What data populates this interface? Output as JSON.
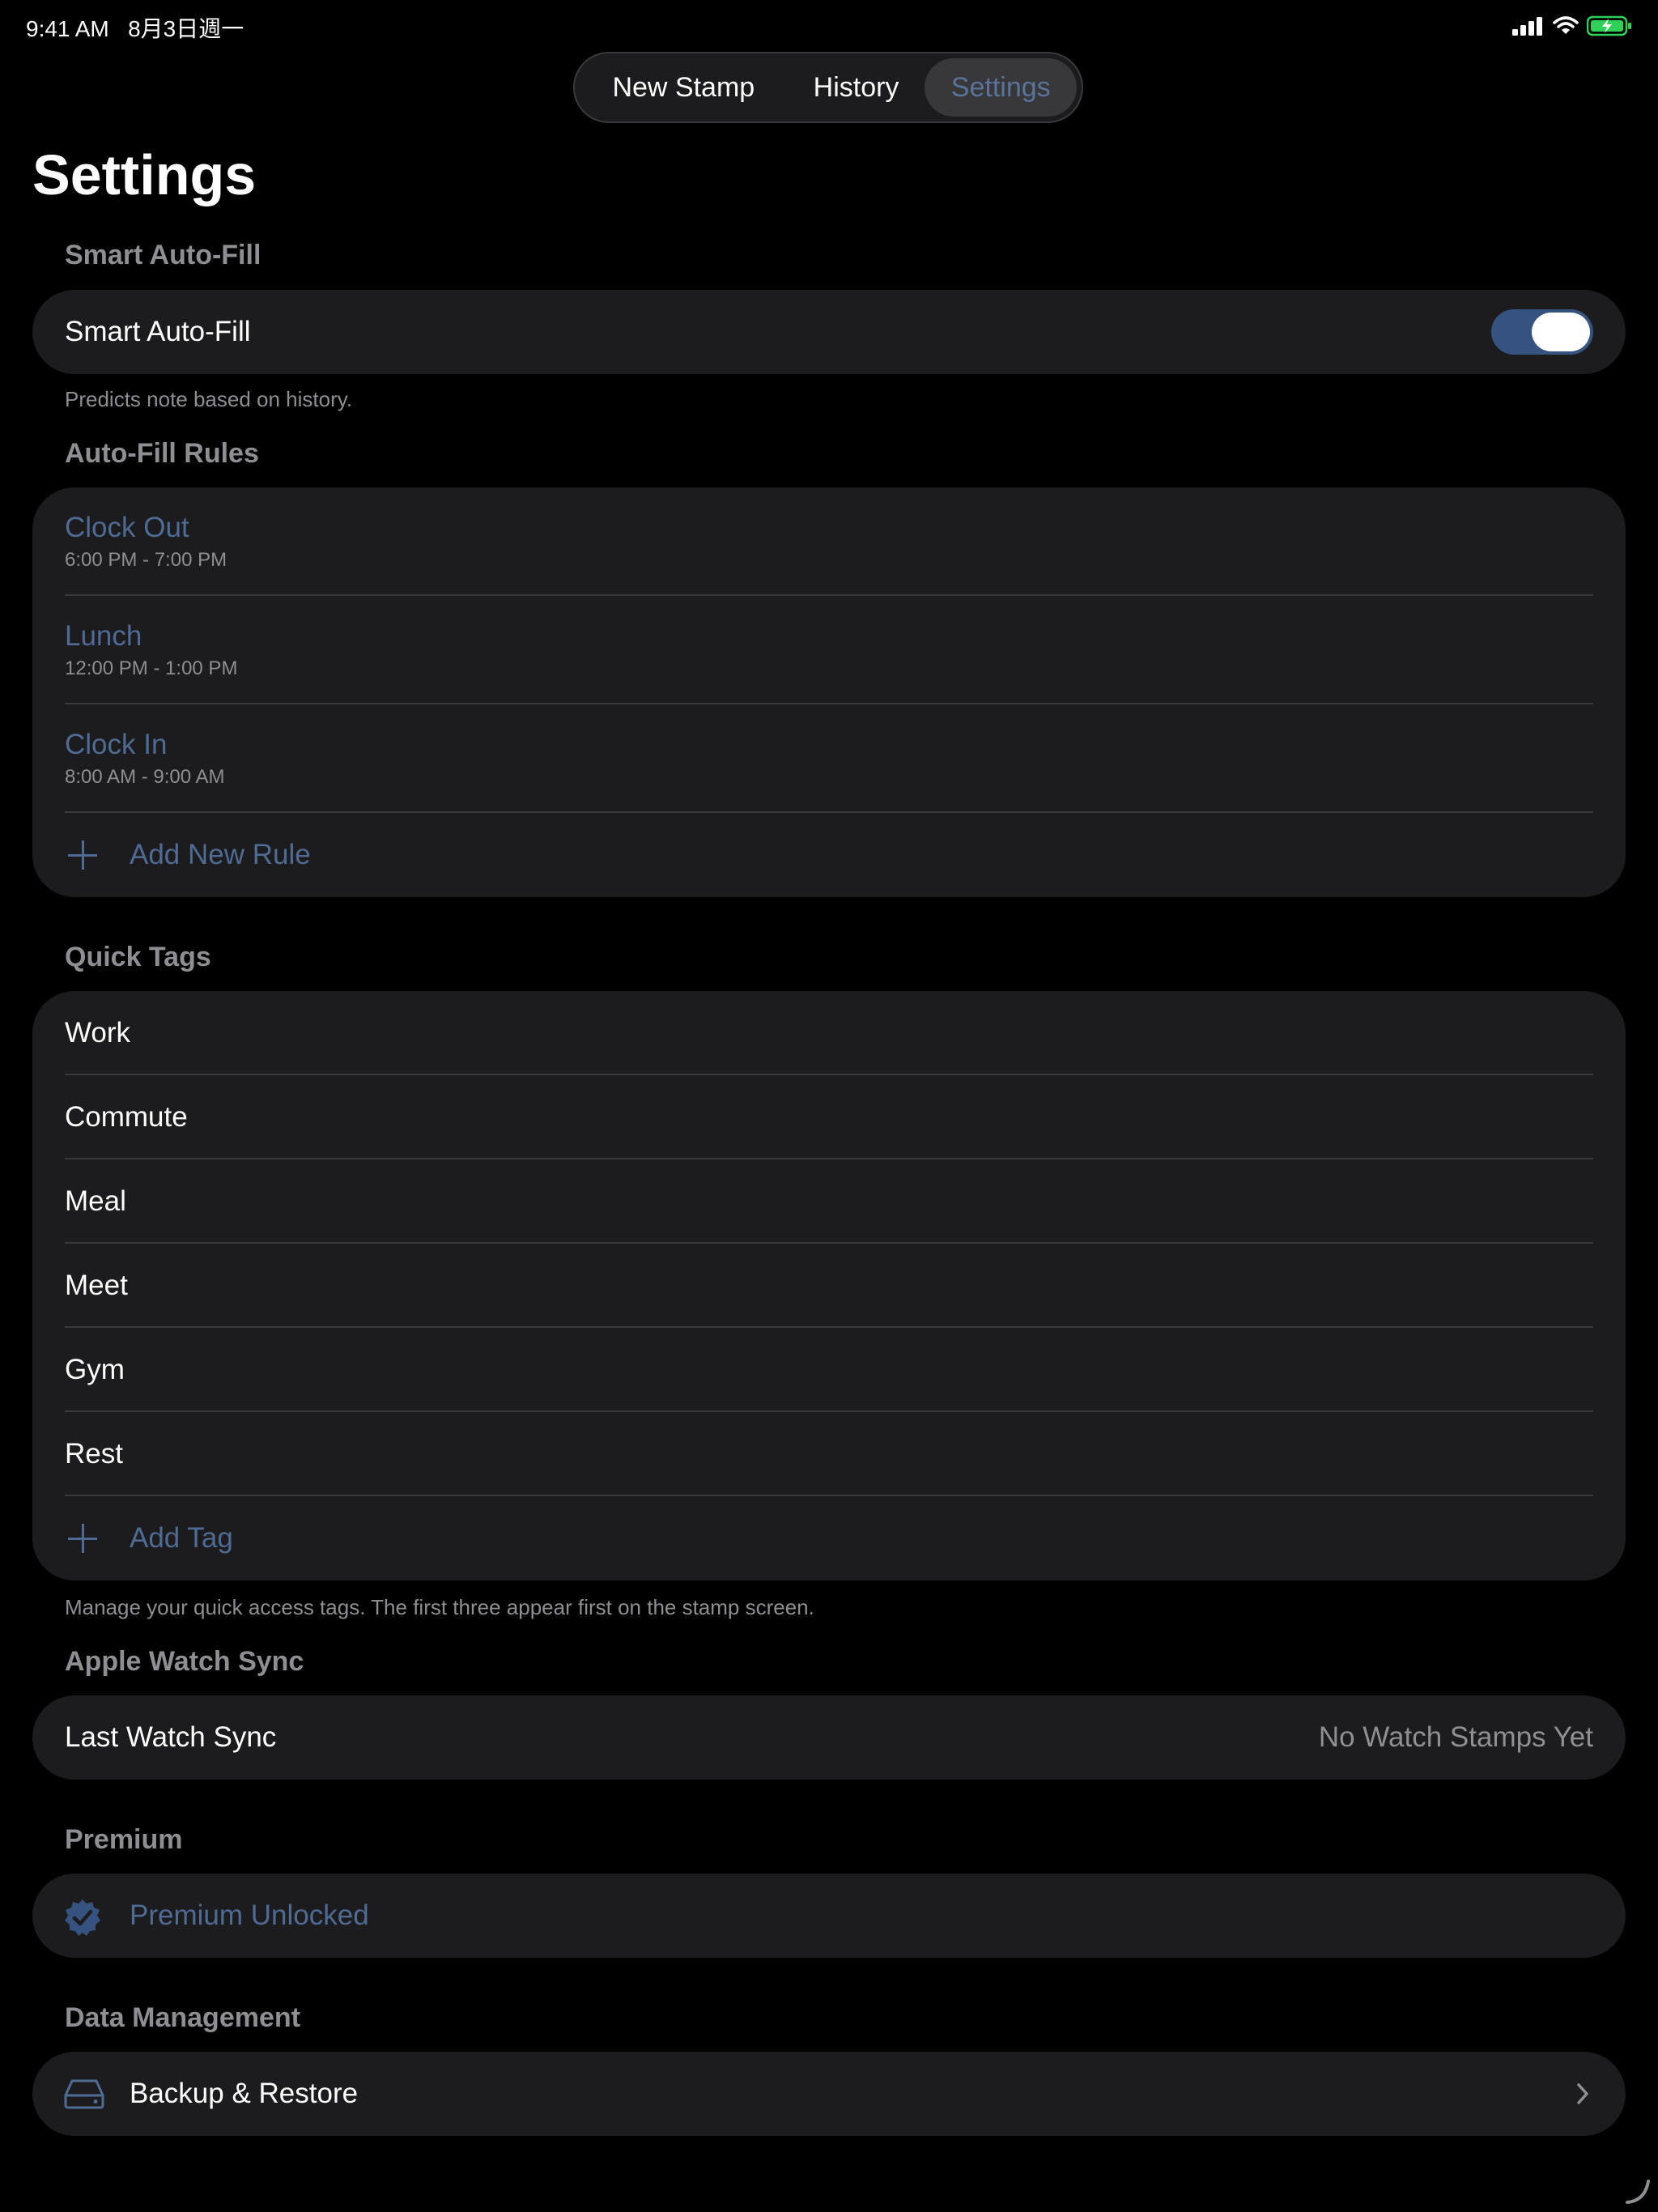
{
  "status_bar": {
    "time": "9:41 AM",
    "date": "8月3日週一",
    "battery_color": "#30d158"
  },
  "tabs": [
    {
      "label": "New Stamp",
      "selected": false
    },
    {
      "label": "History",
      "selected": false
    },
    {
      "label": "Settings",
      "selected": true
    }
  ],
  "page_title": "Settings",
  "smart_autofill": {
    "header": "Smart Auto-Fill",
    "row_label": "Smart Auto-Fill",
    "toggle_on": true,
    "footer": "Predicts note based on history."
  },
  "autofill_rules": {
    "header": "Auto-Fill Rules",
    "rules": [
      {
        "title": "Clock Out",
        "time": "6:00 PM - 7:00 PM"
      },
      {
        "title": "Lunch",
        "time": "12:00 PM - 1:00 PM"
      },
      {
        "title": "Clock In",
        "time": "8:00 AM - 9:00 AM"
      }
    ],
    "add_label": "Add New Rule"
  },
  "quick_tags": {
    "header": "Quick Tags",
    "tags": [
      "Work",
      "Commute",
      "Meal",
      "Meet",
      "Gym",
      "Rest"
    ],
    "add_label": "Add Tag",
    "footer": "Manage your quick access tags. The first three appear first on the stamp screen."
  },
  "watch_sync": {
    "header": "Apple Watch Sync",
    "label": "Last Watch Sync",
    "value": "No Watch Stamps Yet"
  },
  "premium": {
    "header": "Premium",
    "label": "Premium Unlocked",
    "icon": "checkmark-seal-icon"
  },
  "data_management": {
    "header": "Data Management",
    "label": "Backup & Restore",
    "icon": "drive-icon"
  },
  "colors": {
    "accent": "#4f6b94",
    "toggle_on": "#365380",
    "card": "#1c1c1e",
    "secondary_text": "#8e8e93"
  }
}
